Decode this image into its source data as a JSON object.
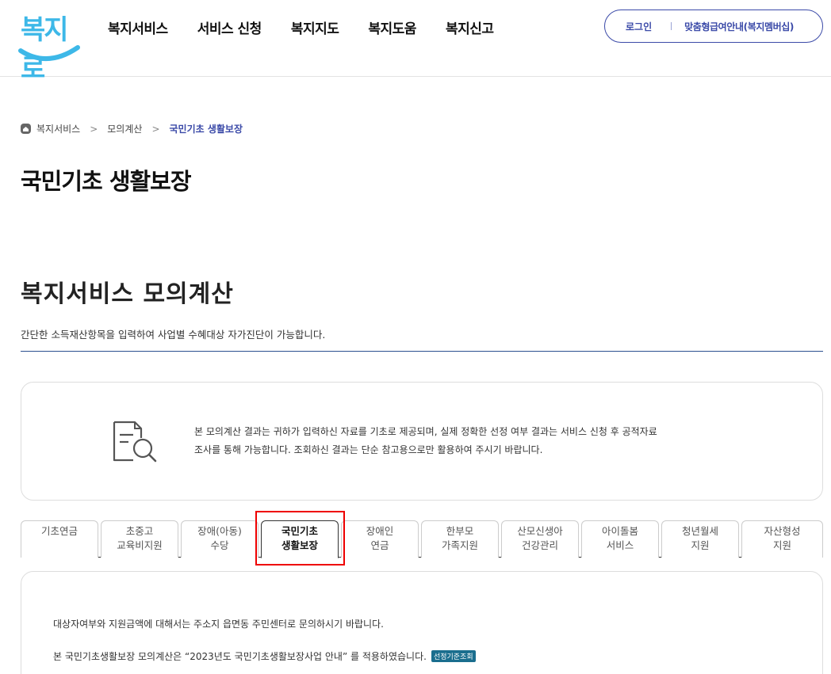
{
  "header": {
    "logo_text": "복지로",
    "nav": [
      "복지서비스",
      "서비스 신청",
      "복지지도",
      "복지도움",
      "복지신고"
    ],
    "login": "로그인",
    "membership": "맞춤형급여안내(복지멤버십)"
  },
  "breadcrumb": {
    "items": [
      "복지서비스",
      "모의계산"
    ],
    "current": "국민기초 생활보장"
  },
  "page_title": "국민기초 생활보장",
  "section": {
    "title": "복지서비스 모의계산",
    "description": "간단한 소득재산항목을 입력하여 사업별 수혜대상 자가진단이 가능합니다."
  },
  "notice": {
    "line1": "본 모의계산 결과는 귀하가 입력하신 자료를 기초로 제공되며, 실제 정확한 선정 여부 결과는 서비스 신청 후 공적자료",
    "line2": "조사를 통해 가능합니다. 조회하신 결과는 단순 참고용으로만 활용하여 주시기 바랍니다."
  },
  "tabs": [
    {
      "l1": "기초연금",
      "l2": ""
    },
    {
      "l1": "초중고",
      "l2": "교육비지원"
    },
    {
      "l1": "장애(아동)",
      "l2": "수당"
    },
    {
      "l1": "국민기초",
      "l2": "생활보장"
    },
    {
      "l1": "장애인",
      "l2": "연금"
    },
    {
      "l1": "한부모",
      "l2": "가족지원"
    },
    {
      "l1": "산모신생아",
      "l2": "건강관리"
    },
    {
      "l1": "아이돌봄",
      "l2": "서비스"
    },
    {
      "l1": "청년월세",
      "l2": "지원"
    },
    {
      "l1": "자산형성",
      "l2": "지원"
    }
  ],
  "active_tab_index": 3,
  "content": {
    "line1": "대상자여부와 지원금액에 대해서는 주소지 읍면동 주민센터로 문의하시기 바랍니다.",
    "line2": "본 국민기초생활보장 모의계산은 “2023년도 국민기초생활보장사업 안내” 를 적용하였습니다.",
    "badge": "선정기준조회"
  },
  "colors": {
    "brand_blue": "#3db8e8",
    "accent_navy": "#3b4aa8",
    "highlight_red": "#e00000"
  }
}
